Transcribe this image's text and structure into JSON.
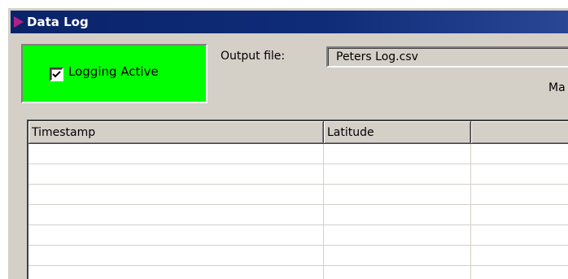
{
  "window": {
    "title": "Data Log",
    "icon": "play-triangle-icon"
  },
  "logging": {
    "checked": true,
    "label": "Logging Active",
    "background_color": "#00ff00"
  },
  "output": {
    "label": "Output file:",
    "value": "Peters Log.csv"
  },
  "partial_label": "Ma",
  "table": {
    "columns": [
      "Timestamp",
      "Latitude",
      ""
    ],
    "rows": [
      [
        "",
        "",
        ""
      ],
      [
        "",
        "",
        ""
      ],
      [
        "",
        "",
        ""
      ],
      [
        "",
        "",
        ""
      ],
      [
        "",
        "",
        ""
      ],
      [
        "",
        "",
        ""
      ],
      [
        "",
        "",
        ""
      ]
    ]
  },
  "colors": {
    "titlebar": "#0a246a",
    "window_face": "#d4d0c8"
  }
}
